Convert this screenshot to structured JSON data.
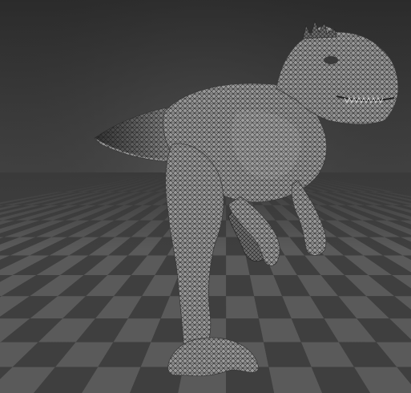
{
  "scene": {
    "subject": "dinosaur-wireframe-model",
    "render_mode": "wireframe",
    "background_colors": {
      "top": "#2b2b2b",
      "center": "#4a4a4a",
      "floor_light": "#5a5a5a",
      "floor_dark": "#3f3f3f"
    },
    "mesh_colors": {
      "fill": "#9a9a9a",
      "wire": "#2a2a2a",
      "highlight": "#c8c8c8",
      "shadow": "#2f2f2f"
    }
  }
}
